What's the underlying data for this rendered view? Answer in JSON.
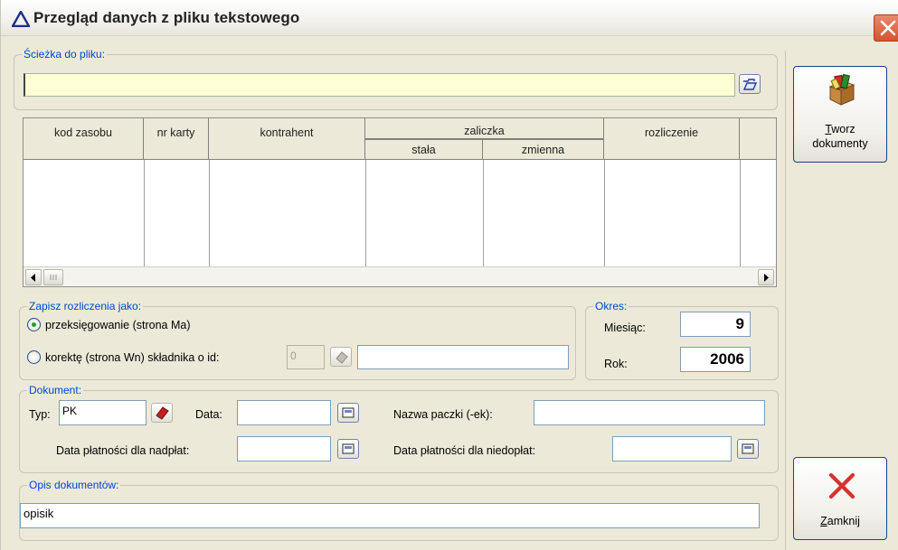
{
  "window": {
    "title": "Przegląd danych z pliku tekstowego"
  },
  "path_group": {
    "legend": "Ścieżka do pliku:",
    "value": ""
  },
  "grid": {
    "columns": [
      "kod zasobu",
      "nr karty",
      "kontrahent",
      "zaliczka",
      "rozliczenie"
    ],
    "subcolumns": [
      "stała",
      "zmienna"
    ],
    "rows": []
  },
  "save_group": {
    "legend": "Zapisz rozliczenia jako:",
    "option1": "przeksięgowanie (strona Ma)",
    "option2": "korektę (strona Wn) składnika o id:",
    "id_value": "0",
    "name_value": "",
    "selected": "option1"
  },
  "period_group": {
    "legend": "Okres:",
    "month_label": "Miesiąc:",
    "month_value": "9",
    "year_label": "Rok:",
    "year_value": "2006"
  },
  "document_group": {
    "legend": "Dokument:",
    "type_label": "Typ:",
    "type_value": "PK",
    "date_label": "Data:",
    "date_value": "",
    "package_label": "Nazwa paczki (-ek):",
    "package_value": "",
    "overpay_label": "Data płatności dla nadpłat:",
    "overpay_value": "",
    "underpay_label": "Data płatności dla niedopłat:",
    "underpay_value": ""
  },
  "desc_group": {
    "legend": "Opis dokumentów:",
    "value": "opisik"
  },
  "buttons": {
    "create_line1": "Tworz",
    "create_line1_rest": "worz",
    "create_line1_first": "T",
    "create_line2": "dokumenty",
    "close_first": "Z",
    "close_rest": "amknij"
  },
  "colors": {
    "legend": "#0046d5",
    "close_x": "#d6312f",
    "path_bg": "#ffffd5"
  }
}
